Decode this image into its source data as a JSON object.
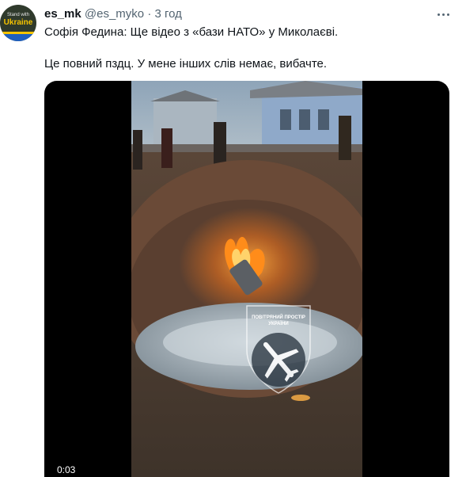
{
  "avatar": {
    "line1": "Stand with",
    "line2": "Ukraine"
  },
  "tweet": {
    "name": "es_mk",
    "handle": "@es_myko",
    "separator": "·",
    "time": "3 год",
    "text_line1": "Софія Федина: Ще відео з «бази НАТО» у Миколаєві.",
    "text_line2": "Це повний пздц. У мене інших слів немає, вибачте."
  },
  "video": {
    "watermark_line1": "ПОВІТРЯНИЙ ПРОСТІР",
    "watermark_line2": "УКРАЇНИ",
    "timestamp": "0:03"
  }
}
